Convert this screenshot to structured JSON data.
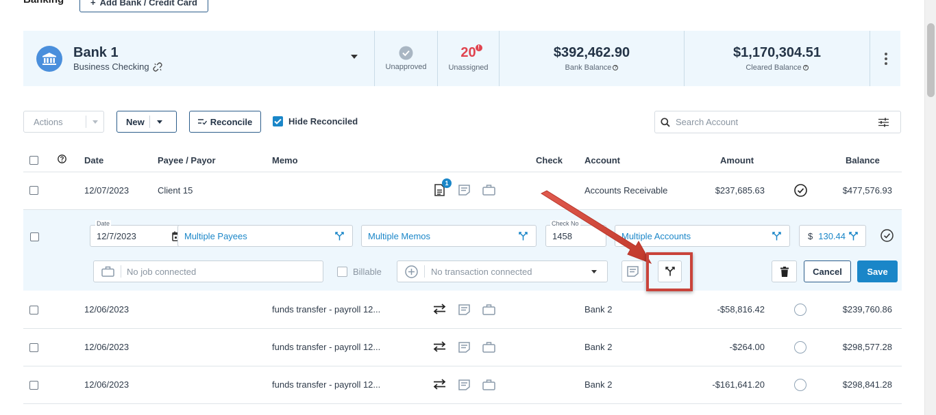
{
  "header": {
    "title": "Banking",
    "add_button_label": "Add Bank / Credit Card"
  },
  "account_summary": {
    "bank_name": "Bank 1",
    "account_type": "Business Checking",
    "unapproved_label": "Unapproved",
    "unassigned_count": "20",
    "unassigned_alert": "!",
    "unassigned_label": "Unassigned",
    "bank_balance": "$392,462.90",
    "bank_balance_label": "Bank Balance",
    "cleared_balance": "$1,170,304.51",
    "cleared_balance_label": "Cleared Balance"
  },
  "toolbar": {
    "actions_label": "Actions",
    "new_label": "New",
    "reconcile_label": "Reconcile",
    "hide_reconciled_label": "Hide Reconciled",
    "hide_reconciled_checked": true,
    "search_placeholder": "Search Account"
  },
  "table": {
    "headers": {
      "date": "Date",
      "payee": "Payee / Payor",
      "memo": "Memo",
      "check": "Check",
      "account": "Account",
      "amount": "Amount",
      "balance": "Balance"
    },
    "rows": [
      {
        "date": "12/07/2023",
        "payee": "Client 15",
        "memo": "",
        "check": "",
        "account": "Accounts Receivable",
        "amount": "$237,685.63",
        "balance": "$477,576.93",
        "attachment_count": "1",
        "status": "approved"
      },
      {
        "date": "12/06/2023",
        "payee": "",
        "memo": "funds transfer - payroll 12...",
        "check": "",
        "account": "Bank 2",
        "amount": "-$58,816.42",
        "balance": "$239,760.86",
        "status": "unapproved"
      },
      {
        "date": "12/06/2023",
        "payee": "",
        "memo": "funds transfer - payroll 12...",
        "check": "",
        "account": "Bank 2",
        "amount": "-$264.00",
        "balance": "$298,577.28",
        "status": "unapproved"
      },
      {
        "date": "12/06/2023",
        "payee": "",
        "memo": "funds transfer - payroll 12...",
        "check": "",
        "account": "Bank 2",
        "amount": "-$161,641.20",
        "balance": "$298,841.28",
        "status": "unapproved"
      }
    ]
  },
  "edit_row": {
    "date_label": "Date",
    "date_value": "12/7/2023",
    "payee_value": "Multiple Payees",
    "memo_value": "Multiple Memos",
    "check_label": "Check No",
    "check_value": "1458",
    "account_value": "Multiple Accounts",
    "currency_symbol": "$",
    "amount_value": "130.44",
    "job_placeholder": "No job connected",
    "billable_label": "Billable",
    "transaction_placeholder": "No transaction connected",
    "cancel_label": "Cancel",
    "save_label": "Save"
  },
  "colors": {
    "accent": "#1a86c8",
    "summary_bg": "#eef7fd",
    "alert": "#e0434f",
    "annotation": "#c9433a"
  },
  "icons": [
    "bank-icon",
    "unlink-icon",
    "check-circle-icon",
    "document-icon",
    "note-icon",
    "briefcase-icon",
    "transfer-icon",
    "split-icon",
    "calendar-icon",
    "trash-icon",
    "search-icon",
    "filter-sliders-icon",
    "plus-circle-icon"
  ]
}
